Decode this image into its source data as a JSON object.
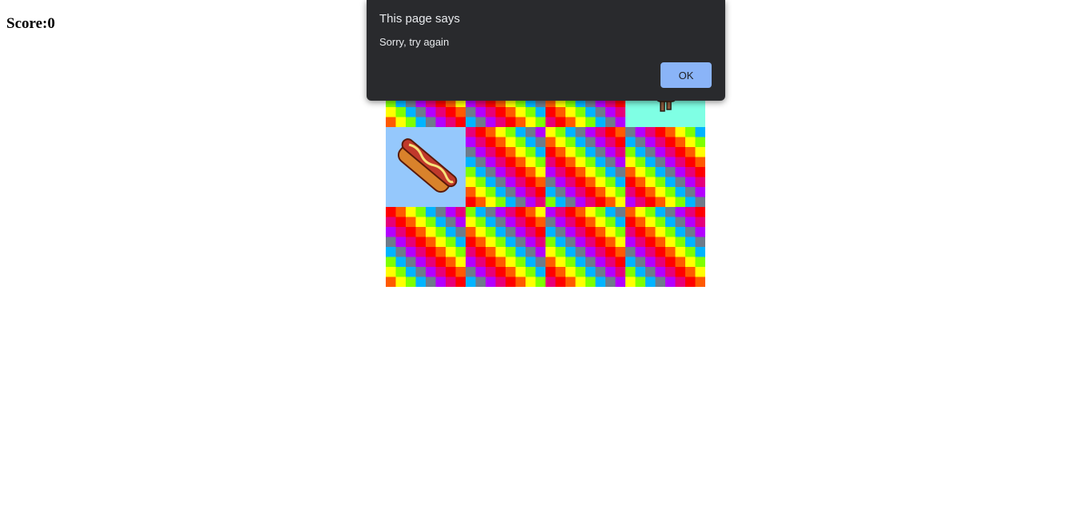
{
  "score": {
    "label": "Score:0"
  },
  "dialog": {
    "title": "This page says",
    "message": "Sorry, try again",
    "ok_label": "OK"
  },
  "board": {
    "columns": 4,
    "rows": 3,
    "tiles": [
      {
        "type": "pattern"
      },
      {
        "type": "pattern"
      },
      {
        "type": "pattern"
      },
      {
        "type": "revealed",
        "item": "dog-sprite",
        "bg": "#7fffe4"
      },
      {
        "type": "revealed",
        "item": "hotdog-sprite",
        "bg": "#95c8fc"
      },
      {
        "type": "pattern"
      },
      {
        "type": "pattern"
      },
      {
        "type": "pattern"
      },
      {
        "type": "pattern"
      },
      {
        "type": "pattern"
      },
      {
        "type": "pattern"
      },
      {
        "type": "pattern"
      }
    ],
    "pattern_colors": [
      "#ff0000",
      "#ff5a00",
      "#ffff00",
      "#7fff00",
      "#00b4ff",
      "#6e7b8b",
      "#b400ff",
      "#e6007a"
    ]
  },
  "colors": {
    "dialog_bg": "#292a2d",
    "ok_button": "#8ab4f8"
  }
}
